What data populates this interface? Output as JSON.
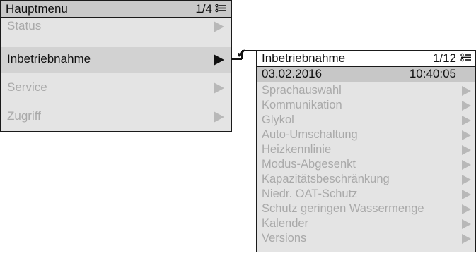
{
  "main_menu": {
    "title": "Hauptmenu",
    "page_indicator": "1/4",
    "items": [
      {
        "label": "Status",
        "selected": false
      },
      {
        "label": "Inbetriebnahme",
        "selected": true
      },
      {
        "label": "Service",
        "selected": false
      },
      {
        "label": "Zugriff",
        "selected": false
      }
    ]
  },
  "connector": {
    "checkmark": "✔"
  },
  "sub_menu": {
    "title": "Inbetriebnahme",
    "page_indicator": "1/12",
    "date": "03.02.2016",
    "time": "10:40:05",
    "items": [
      {
        "label": "Sprachauswahl"
      },
      {
        "label": "Kommunikation"
      },
      {
        "label": "Glykol"
      },
      {
        "label": "Auto-Umschaltung"
      },
      {
        "label": "Heizkennlinie"
      },
      {
        "label": "Modus-Abgesenkt"
      },
      {
        "label": "Kapazitätsbeschränkung"
      },
      {
        "label": "Niedr. OAT-Schutz"
      },
      {
        "label": "Schutz geringen Wassermenge"
      },
      {
        "label": "Kalender"
      },
      {
        "label": "Versions"
      }
    ]
  },
  "colors": {
    "panel_background": "#e4e4e4",
    "header_background": "#c9c9c9",
    "selected_background": "#d2d2d2",
    "datetime_background": "#c7c7c7",
    "disabled_text": "#a9a9a9",
    "active_text": "#111111",
    "inactive_arrow": "#b8b8b8",
    "active_arrow": "#111111"
  },
  "icons": {
    "header_list": "list-icon",
    "item_arrow": "triangle-right-icon",
    "connector_check": "checkmark-icon"
  }
}
